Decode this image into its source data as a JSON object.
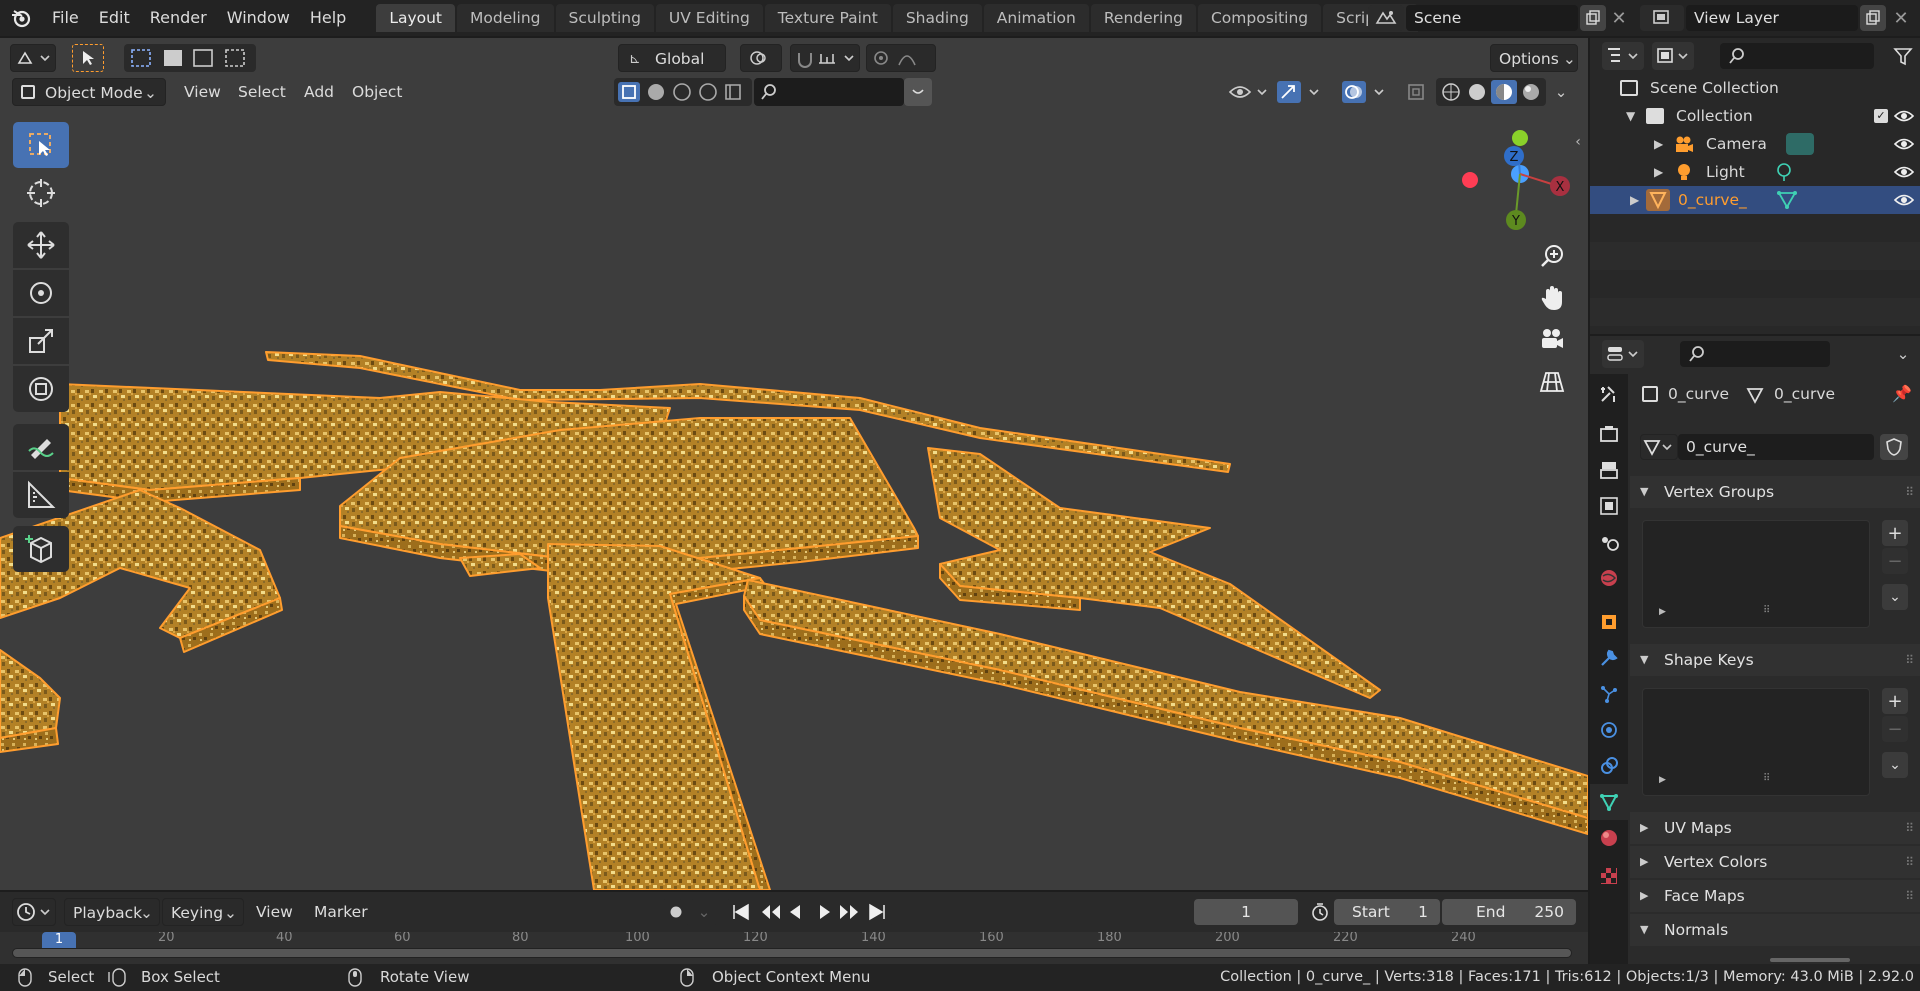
{
  "menu": {
    "file": "File",
    "edit": "Edit",
    "render": "Render",
    "window": "Window",
    "help": "Help"
  },
  "workspaces": [
    "Layout",
    "Modeling",
    "Sculpting",
    "UV Editing",
    "Texture Paint",
    "Shading",
    "Animation",
    "Rendering",
    "Compositing",
    "Scripting"
  ],
  "scene": {
    "name": "Scene",
    "view_layer": "View Layer"
  },
  "viewport_header": {
    "transform_orientation": "Global",
    "options": "Options",
    "mode": "Object Mode",
    "view": "View",
    "select": "Select",
    "add": "Add",
    "object": "Object"
  },
  "gizmo": {
    "z": "Z",
    "x": "X",
    "y": "Y"
  },
  "outliner": {
    "scene_collection": "Scene Collection",
    "collection": "Collection",
    "items": [
      {
        "label": "Camera"
      },
      {
        "label": "Light"
      },
      {
        "label": "0_curve_"
      }
    ]
  },
  "properties": {
    "object_name": "0_curve",
    "data_name": "0_curve",
    "datablock": "0_curve_",
    "panels": {
      "vertex_groups": "Vertex Groups",
      "shape_keys": "Shape Keys",
      "uv_maps": "UV Maps",
      "vertex_colors": "Vertex Colors",
      "face_maps": "Face Maps",
      "normals": "Normals"
    }
  },
  "timeline": {
    "playback": "Playback",
    "keying": "Keying",
    "view": "View",
    "marker": "Marker",
    "current_frame": "1",
    "start_label": "Start",
    "start": "1",
    "end_label": "End",
    "end": "250",
    "ruler": [
      "1",
      "20",
      "40",
      "60",
      "80",
      "100",
      "120",
      "140",
      "160",
      "180",
      "200",
      "220",
      "240"
    ]
  },
  "statusbar": {
    "select": "Select",
    "box_select": "Box Select",
    "rotate_view": "Rotate View",
    "context_menu": "Object Context Menu",
    "stats": "Collection | 0_curve_ | Verts:318 | Faces:171 | Tris:612 | Objects:1/3 | Memory: 43.0 MiB | 2.92.0"
  },
  "colors": {
    "accent": "#4772b3",
    "object_orange": "#ff9d2e",
    "mesh_gold": "#b8862a",
    "viewport_bg": "#3d3d3d"
  }
}
